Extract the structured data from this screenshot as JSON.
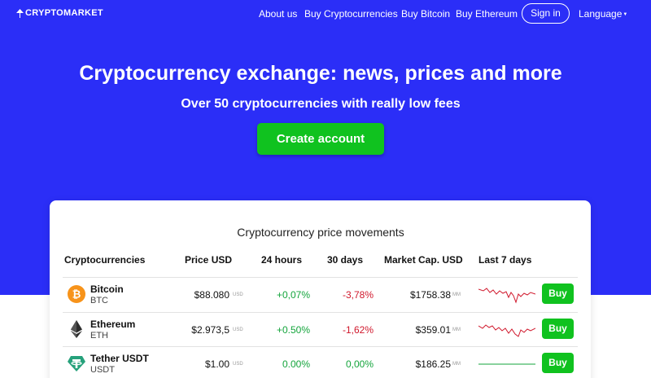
{
  "nav": {
    "logo": "CRYPTOMARKET",
    "links": [
      "About us",
      "Buy Cryptocurrencies",
      "Buy Bitcoin",
      "Buy Ethereum"
    ],
    "sign_in": "Sign in",
    "language": "Language"
  },
  "hero": {
    "title": "Cryptocurrency exchange: news, prices and more",
    "subtitle": "Over 50 cryptocurrencies with really low fees",
    "cta": "Create account"
  },
  "table": {
    "title": "Cryptocurrency price movements",
    "headers": [
      "Cryptocurrencies",
      "Price USD",
      "24 hours",
      "30 days",
      "Market Cap. USD",
      "Last 7 days"
    ],
    "rows": [
      {
        "name": "Bitcoin",
        "symbol": "BTC",
        "price": "$88.080",
        "price_unit": "USD",
        "change_24h": "+0,07%",
        "change_30d": "-3,78%",
        "market_cap": "$1758.38",
        "market_cap_unit": "MM",
        "trend": "volatile",
        "buy": "Buy",
        "icon": "bitcoin-icon"
      },
      {
        "name": "Ethereum",
        "symbol": "ETH",
        "price": "$2.973,5",
        "price_unit": "USD",
        "change_24h": "+0.50%",
        "change_30d": "-1,62%",
        "market_cap": "$359.01",
        "market_cap_unit": "MM",
        "trend": "volatile",
        "buy": "Buy",
        "icon": "ethereum-icon"
      },
      {
        "name": "Tether USDT",
        "symbol": "USDT",
        "price": "$1.00",
        "price_unit": "USD",
        "change_24h": "0.00%",
        "change_30d": "0,00%",
        "market_cap": "$186.25",
        "market_cap_unit": "MM",
        "trend": "flat",
        "buy": "Buy",
        "icon": "tether-icon"
      }
    ]
  },
  "colors": {
    "brand_blue": "#2b2ef7",
    "buy_green": "#10c21f",
    "positive": "#13a43b",
    "negative": "#d0182c"
  }
}
